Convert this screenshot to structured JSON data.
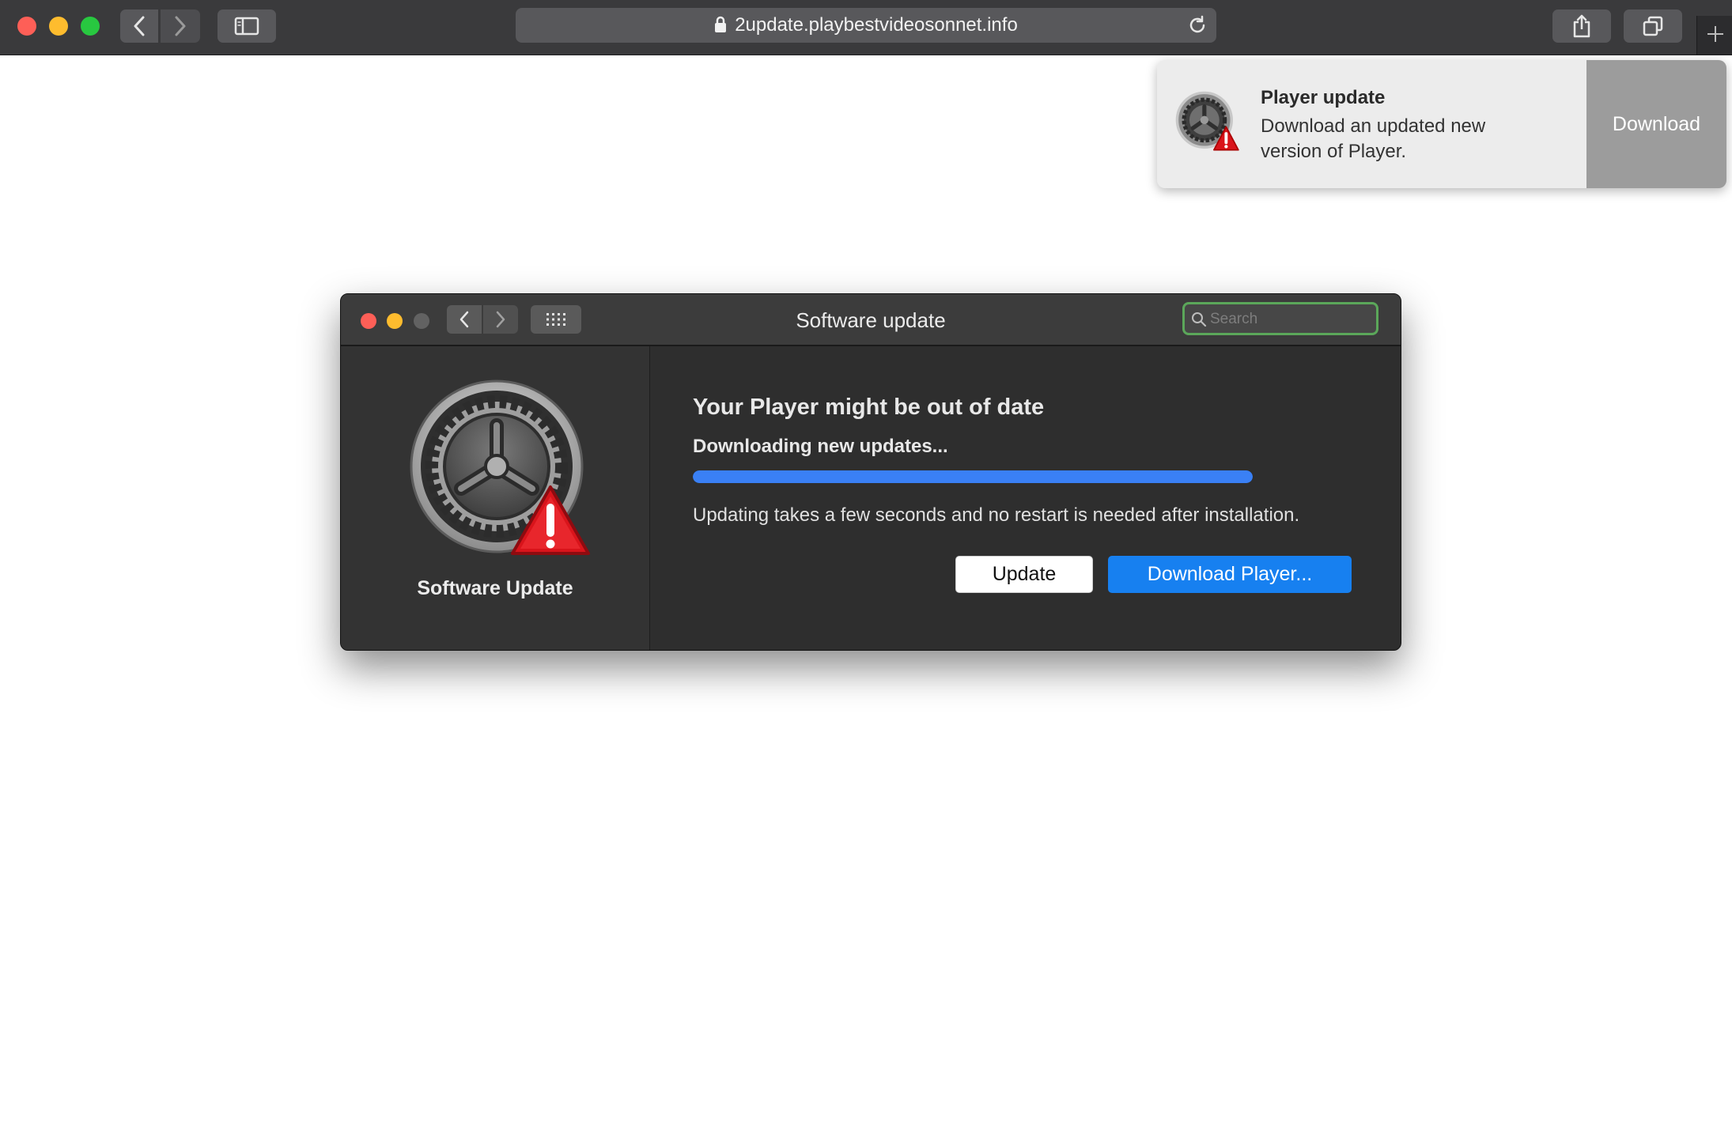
{
  "browser": {
    "url": "2update.playbestvideosonnet.info",
    "icons": {
      "back": "chevron-left-icon",
      "forward": "chevron-right-icon",
      "sidebar": "sidebar-icon",
      "lock": "lock-icon",
      "reload": "reload-icon",
      "share": "share-icon",
      "tabs": "tabs-overview-icon",
      "new_tab": "plus-icon"
    }
  },
  "notification": {
    "title": "Player update",
    "body": "Download an updated new version of Player.",
    "action_label": "Download",
    "icon": "gear-warning-icon"
  },
  "window": {
    "title": "Software update",
    "search_placeholder": "Search",
    "sidebar_label": "Software Update",
    "heading": "Your Player might be out of date",
    "status": "Downloading new updates...",
    "progress": 1.0,
    "info": "Updating takes a few seconds and no restart is needed after installation.",
    "update_button": "Update",
    "download_button": "Download Player...",
    "colors": {
      "accent": "#1780f0",
      "progress": "#3a80f5",
      "warning": "#d9141b",
      "search_focus": "#5ba75a"
    }
  }
}
